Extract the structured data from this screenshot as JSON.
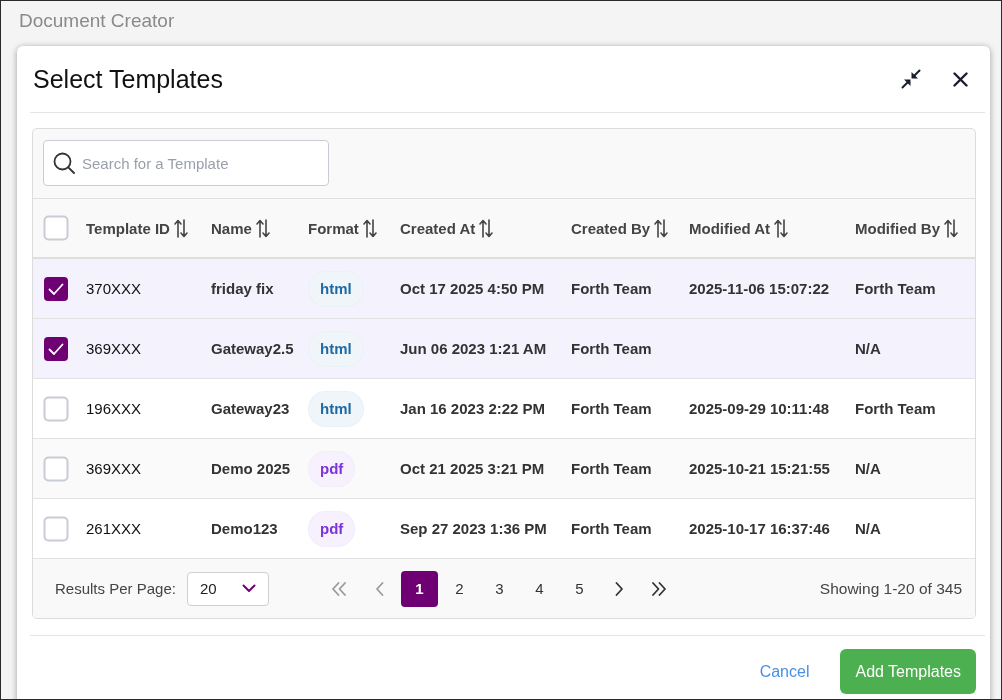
{
  "app": {
    "title": "Document Creator"
  },
  "dialog": {
    "title": "Select Templates"
  },
  "search": {
    "placeholder": "Search for a Template"
  },
  "table": {
    "select_all_checked": false,
    "columns": [
      "Template ID",
      "Name",
      "Format",
      "Created At",
      "Created By",
      "Modified At",
      "Modified By"
    ],
    "rows": [
      {
        "checked": true,
        "template_id": "370XXX",
        "name": "friday fix",
        "format": {
          "label": "html",
          "color": "#1f6aa5"
        },
        "created_at": "Oct 17 2025 4:50 PM",
        "created_by": "Forth Team",
        "modified_at": "2025-11-06 15:07:22",
        "modified_by": "Forth Team"
      },
      {
        "checked": true,
        "template_id": "369XXX",
        "name": "Gateway2.5",
        "format": {
          "label": "html",
          "color": "#1f6aa5"
        },
        "created_at": "Jun 06 2023 1:21 AM",
        "created_by": "Forth Team",
        "modified_by": "N/A"
      },
      {
        "checked": false,
        "template_id": "196XXX",
        "name": "Gateway23",
        "format": {
          "label": "html",
          "color": "#1f6aa5"
        },
        "created_at": "Jan 16 2023 2:22 PM",
        "created_by": "Forth Team",
        "modified_at": "2025-09-29 10:11:48",
        "modified_by": "Forth Team"
      },
      {
        "checked": false,
        "template_id": "369XXX",
        "name": "Demo 2025",
        "format": {
          "label": "pdf",
          "color": "#7b35d9"
        },
        "created_at": "Oct 21 2025 3:21 PM",
        "created_by": "Forth Team",
        "modified_at": "2025-10-21 15:21:55",
        "modified_by": "N/A"
      },
      {
        "checked": false,
        "template_id": "261XXX",
        "name": "Demo123",
        "format": {
          "label": "pdf",
          "color": "#7b35d9"
        },
        "created_at": "Sep 27 2023 1:36 PM",
        "created_by": "Forth Team",
        "modified_at": "2025-10-17 16:37:46",
        "modified_by": "N/A"
      }
    ]
  },
  "pagination": {
    "results_label": "Results Per Page:",
    "per_page": "20",
    "controls": [
      {
        "kind": "first",
        "disabled": true
      },
      {
        "kind": "prev",
        "disabled": true
      },
      {
        "kind": "page",
        "label": "1",
        "selected": true
      },
      {
        "kind": "page",
        "label": "2",
        "selected": false
      },
      {
        "kind": "page",
        "label": "3",
        "selected": false
      },
      {
        "kind": "page",
        "label": "4",
        "selected": false
      },
      {
        "kind": "page",
        "label": "5",
        "selected": false
      },
      {
        "kind": "next",
        "disabled": false
      },
      {
        "kind": "last",
        "disabled": false
      }
    ],
    "summary": "Showing 1-20 of 345"
  },
  "buttons": {
    "cancel": "Cancel",
    "confirm": "Add Templates"
  }
}
